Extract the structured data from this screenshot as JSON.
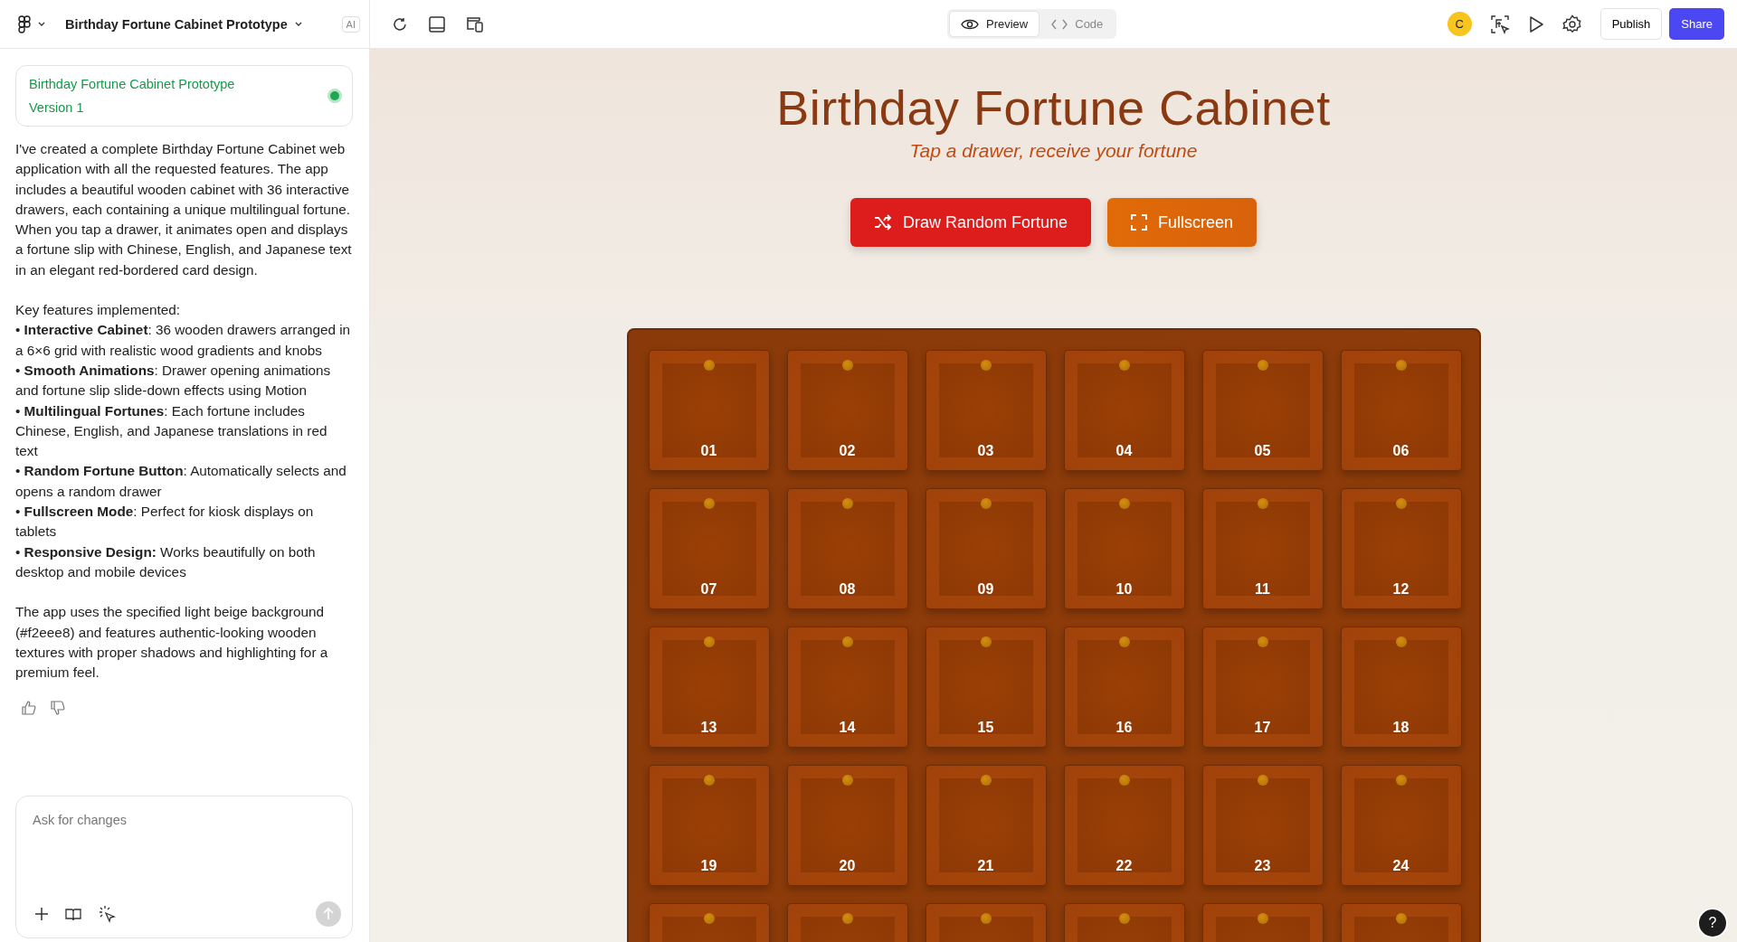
{
  "topbar": {
    "project_title": "Birthday Fortune Cabinet Prototype",
    "ai_badge": "AI",
    "view_tabs": [
      {
        "label": "Preview",
        "selected": true
      },
      {
        "label": "Code",
        "selected": false
      }
    ],
    "avatar": "C",
    "publish": "Publish",
    "share": "Share"
  },
  "sidebar": {
    "version_card": {
      "title": "Birthday Fortune Cabinet Prototype",
      "version": "Version 1"
    },
    "message": [
      {
        "kind": "text",
        "text": "I've created a complete Birthday Fortune Cabinet web application with all the requested features. The app includes a beautiful wooden cabinet with 36 interactive drawers, each containing a unique multilingual fortune. When you tap a drawer, it animates open and displays a fortune slip with Chinese, English, and Japanese text in an elegant red-bordered card design."
      },
      {
        "kind": "gap"
      },
      {
        "kind": "text",
        "text": "Key features implemented:"
      },
      {
        "kind": "text",
        "text": "• **Interactive Cabinet**: 36 wooden drawers arranged in a 6×6 grid with realistic wood gradients and knobs"
      },
      {
        "kind": "text",
        "text": "• **Smooth Animations**: Drawer opening animations and fortune slip slide-down effects using Motion"
      },
      {
        "kind": "text",
        "text": "• **Multilingual Fortunes**: Each fortune includes Chinese, English, and Japanese translations in red text"
      },
      {
        "kind": "text",
        "text": "• **Random Fortune Button**: Automatically selects and opens a random drawer"
      },
      {
        "kind": "text",
        "text": "• **Fullscreen Mode**: Perfect for kiosk displays on tablets"
      },
      {
        "kind": "text",
        "text": "• **Responsive Design:** Works beautifully on both desktop and mobile devices"
      },
      {
        "kind": "gap"
      },
      {
        "kind": "text",
        "text": "The app uses the specified light beige background (#f2eee8) and features authentic-looking wooden textures with proper shadows and highlighting for a premium feel."
      }
    ],
    "input": {
      "placeholder": "Ask for changes"
    }
  },
  "preview": {
    "title": "Birthday Fortune Cabinet",
    "subtitle": "Tap a drawer, receive your fortune",
    "buttons": [
      {
        "kind": "random",
        "label": "Draw Random Fortune"
      },
      {
        "kind": "fullscreen",
        "label": "Fullscreen"
      }
    ],
    "drawers": [
      {
        "kind": "full",
        "label": "01"
      },
      {
        "kind": "full",
        "label": "02"
      },
      {
        "kind": "full",
        "label": "03"
      },
      {
        "kind": "full",
        "label": "04"
      },
      {
        "kind": "full",
        "label": "05"
      },
      {
        "kind": "full",
        "label": "06"
      },
      {
        "kind": "full",
        "label": "07"
      },
      {
        "kind": "full",
        "label": "08"
      },
      {
        "kind": "full",
        "label": "09"
      },
      {
        "kind": "full",
        "label": "10"
      },
      {
        "kind": "full",
        "label": "11"
      },
      {
        "kind": "full",
        "label": "12"
      },
      {
        "kind": "full",
        "label": "13"
      },
      {
        "kind": "full",
        "label": "14"
      },
      {
        "kind": "full",
        "label": "15"
      },
      {
        "kind": "full",
        "label": "16"
      },
      {
        "kind": "full",
        "label": "17"
      },
      {
        "kind": "full",
        "label": "18"
      },
      {
        "kind": "full",
        "label": "19"
      },
      {
        "kind": "full",
        "label": "20"
      },
      {
        "kind": "full",
        "label": "21"
      },
      {
        "kind": "full",
        "label": "22"
      },
      {
        "kind": "full",
        "label": "23"
      },
      {
        "kind": "full",
        "label": "24"
      },
      {
        "kind": "partial"
      },
      {
        "kind": "partial"
      },
      {
        "kind": "partial"
      },
      {
        "kind": "partial"
      },
      {
        "kind": "partial"
      },
      {
        "kind": "partial"
      }
    ],
    "help": "?"
  }
}
